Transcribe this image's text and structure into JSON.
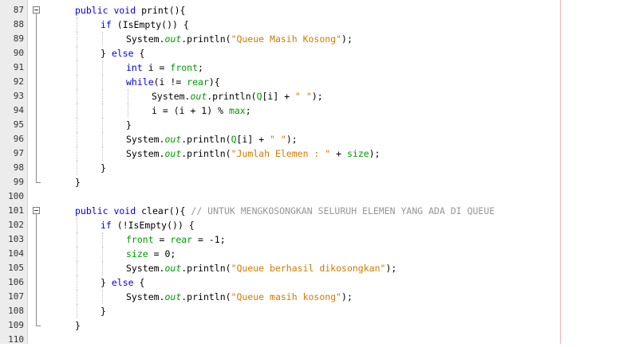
{
  "editor": {
    "lines": [
      {
        "n": "87",
        "indent": 1,
        "tokens": [
          {
            "t": "public void ",
            "c": "kw"
          },
          {
            "t": "print(){",
            "c": ""
          }
        ],
        "fold": "start"
      },
      {
        "n": "88",
        "indent": 2,
        "tokens": [
          {
            "t": "if",
            "c": "kw"
          },
          {
            "t": " (IsEmpty()) {",
            "c": ""
          }
        ]
      },
      {
        "n": "89",
        "indent": 3,
        "tokens": [
          {
            "t": "System.",
            "c": ""
          },
          {
            "t": "out",
            "c": "mth"
          },
          {
            "t": ".println(",
            "c": ""
          },
          {
            "t": "\"Queue Masih Kosong\"",
            "c": "str"
          },
          {
            "t": ");",
            "c": ""
          }
        ]
      },
      {
        "n": "90",
        "indent": 2,
        "tokens": [
          {
            "t": "} ",
            "c": ""
          },
          {
            "t": "else",
            "c": "kw"
          },
          {
            "t": " {",
            "c": ""
          }
        ]
      },
      {
        "n": "91",
        "indent": 3,
        "tokens": [
          {
            "t": "int",
            "c": "kw"
          },
          {
            "t": " i = ",
            "c": ""
          },
          {
            "t": "front",
            "c": "fld"
          },
          {
            "t": ";",
            "c": ""
          }
        ]
      },
      {
        "n": "92",
        "indent": 3,
        "tokens": [
          {
            "t": "while",
            "c": "kw"
          },
          {
            "t": "(i != ",
            "c": ""
          },
          {
            "t": "rear",
            "c": "fld"
          },
          {
            "t": "){",
            "c": ""
          }
        ]
      },
      {
        "n": "93",
        "indent": 4,
        "tokens": [
          {
            "t": "System.",
            "c": ""
          },
          {
            "t": "out",
            "c": "mth"
          },
          {
            "t": ".println(",
            "c": ""
          },
          {
            "t": "Q",
            "c": "fld"
          },
          {
            "t": "[i] + ",
            "c": ""
          },
          {
            "t": "\" \"",
            "c": "str"
          },
          {
            "t": ");",
            "c": ""
          }
        ]
      },
      {
        "n": "94",
        "indent": 4,
        "tokens": [
          {
            "t": "i = (i + 1) % ",
            "c": ""
          },
          {
            "t": "max",
            "c": "fld"
          },
          {
            "t": ";",
            "c": ""
          }
        ]
      },
      {
        "n": "95",
        "indent": 3,
        "tokens": [
          {
            "t": "}",
            "c": ""
          }
        ]
      },
      {
        "n": "96",
        "indent": 3,
        "tokens": [
          {
            "t": "System.",
            "c": ""
          },
          {
            "t": "out",
            "c": "mth"
          },
          {
            "t": ".println(",
            "c": ""
          },
          {
            "t": "Q",
            "c": "fld"
          },
          {
            "t": "[i] + ",
            "c": ""
          },
          {
            "t": "\" \"",
            "c": "str"
          },
          {
            "t": ");",
            "c": ""
          }
        ]
      },
      {
        "n": "97",
        "indent": 3,
        "tokens": [
          {
            "t": "System.",
            "c": ""
          },
          {
            "t": "out",
            "c": "mth"
          },
          {
            "t": ".println(",
            "c": ""
          },
          {
            "t": "\"Jumlah Elemen : \"",
            "c": "str"
          },
          {
            "t": " + ",
            "c": ""
          },
          {
            "t": "size",
            "c": "fld"
          },
          {
            "t": ");",
            "c": ""
          }
        ]
      },
      {
        "n": "98",
        "indent": 2,
        "tokens": [
          {
            "t": "}",
            "c": ""
          }
        ]
      },
      {
        "n": "99",
        "indent": 1,
        "tokens": [
          {
            "t": "}",
            "c": ""
          }
        ],
        "fold": "end"
      },
      {
        "n": "100",
        "indent": 0,
        "tokens": []
      },
      {
        "n": "101",
        "indent": 1,
        "tokens": [
          {
            "t": "public void ",
            "c": "kw"
          },
          {
            "t": "clear(){ ",
            "c": ""
          },
          {
            "t": "// UNTUK MENGKOSONGKAN SELURUH ELEMEN YANG ADA DI QUEUE",
            "c": "cmt"
          }
        ],
        "fold": "start"
      },
      {
        "n": "102",
        "indent": 2,
        "tokens": [
          {
            "t": "if",
            "c": "kw"
          },
          {
            "t": " (!IsEmpty()) {",
            "c": ""
          }
        ]
      },
      {
        "n": "103",
        "indent": 3,
        "tokens": [
          {
            "t": "front",
            "c": "fld"
          },
          {
            "t": " = ",
            "c": ""
          },
          {
            "t": "rear",
            "c": "fld"
          },
          {
            "t": " = -1;",
            "c": ""
          }
        ]
      },
      {
        "n": "104",
        "indent": 3,
        "tokens": [
          {
            "t": "size",
            "c": "fld"
          },
          {
            "t": " = 0;",
            "c": ""
          }
        ]
      },
      {
        "n": "105",
        "indent": 3,
        "tokens": [
          {
            "t": "System.",
            "c": ""
          },
          {
            "t": "out",
            "c": "mth"
          },
          {
            "t": ".println(",
            "c": ""
          },
          {
            "t": "\"Queue berhasil dikosongkan\"",
            "c": "str"
          },
          {
            "t": ");",
            "c": ""
          }
        ]
      },
      {
        "n": "106",
        "indent": 2,
        "tokens": [
          {
            "t": "} ",
            "c": ""
          },
          {
            "t": "else",
            "c": "kw"
          },
          {
            "t": " {",
            "c": ""
          }
        ]
      },
      {
        "n": "107",
        "indent": 3,
        "tokens": [
          {
            "t": "System.",
            "c": ""
          },
          {
            "t": "out",
            "c": "mth"
          },
          {
            "t": ".println(",
            "c": ""
          },
          {
            "t": "\"Queue masih kosong\"",
            "c": "str"
          },
          {
            "t": ");",
            "c": ""
          }
        ]
      },
      {
        "n": "108",
        "indent": 2,
        "tokens": [
          {
            "t": "}",
            "c": ""
          }
        ]
      },
      {
        "n": "109",
        "indent": 1,
        "tokens": [
          {
            "t": "}",
            "c": ""
          }
        ],
        "fold": "end"
      },
      {
        "n": "110",
        "indent": 0,
        "tokens": []
      }
    ]
  },
  "colors": {
    "keyword": "#0000e6",
    "string": "#ce7b00",
    "field": "#009900",
    "comment": "#969696",
    "gutter": "#ececec",
    "margin_line": "#f0b4b4"
  },
  "icons": {
    "fold_toggle": "collapse-minus-icon"
  }
}
